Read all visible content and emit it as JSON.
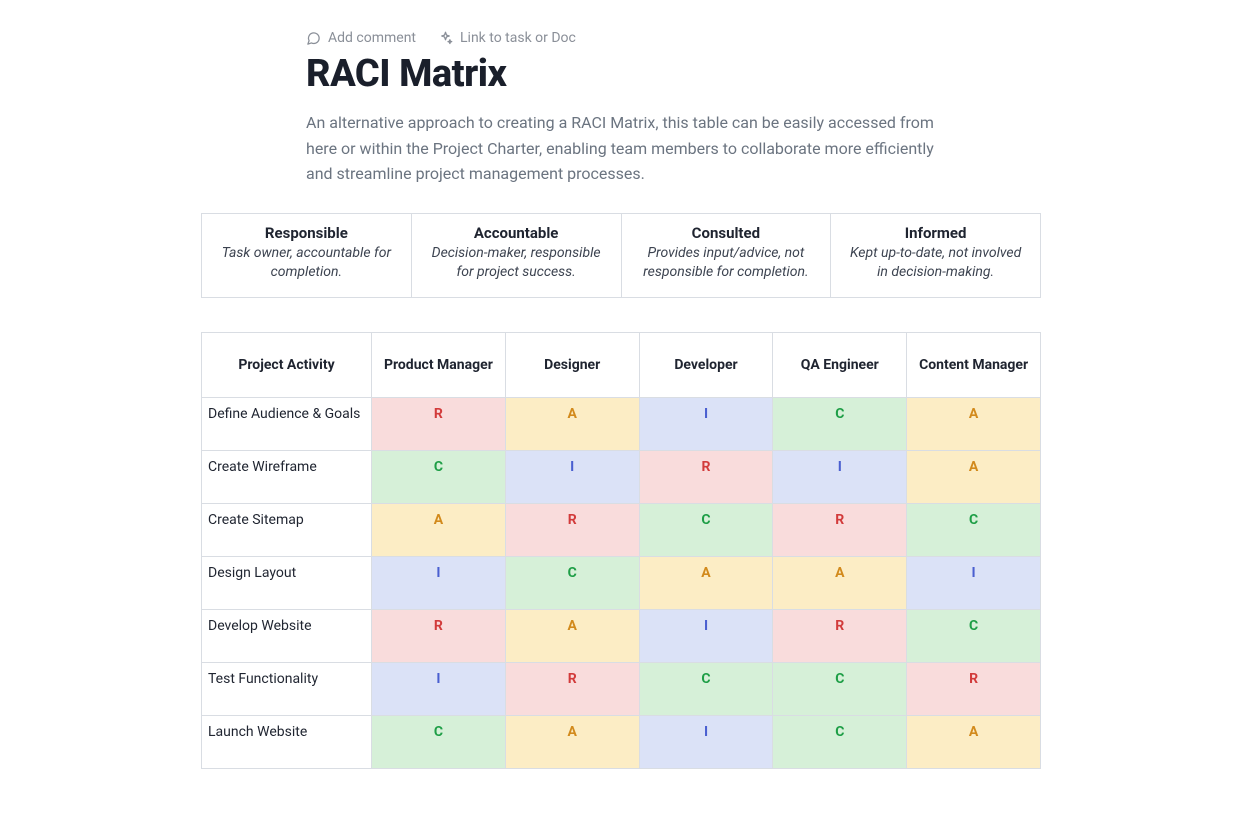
{
  "toolbar": {
    "add_comment": "Add comment",
    "link_task": "Link to task or Doc"
  },
  "title": "RACI Matrix",
  "description": "An alternative approach to creating a RACI Matrix, this table can be easily accessed from here or within the Project Charter, enabling team members to collaborate more efficiently and streamline project management processes.",
  "legend": [
    {
      "title": "Responsible",
      "sub": "Task owner, accountable for completion."
    },
    {
      "title": "Accountable",
      "sub": "Decision-maker, responsible for project success."
    },
    {
      "title": "Consulted",
      "sub": "Provides input/advice, not responsible for completion."
    },
    {
      "title": "Informed",
      "sub": "Kept up-to-date, not involved in decision-making."
    }
  ],
  "matrix": {
    "first_col_header": "Project Activity",
    "roles": [
      "Product Manager",
      "Designer",
      "Developer",
      "QA Engineer",
      "Content Manager"
    ],
    "rows": [
      {
        "activity": "Define Audience & Goals",
        "cells": [
          "R",
          "A",
          "I",
          "C",
          "A"
        ]
      },
      {
        "activity": "Create Wireframe",
        "cells": [
          "C",
          "I",
          "R",
          "I",
          "A"
        ]
      },
      {
        "activity": "Create Sitemap",
        "cells": [
          "A",
          "R",
          "C",
          "R",
          "C"
        ]
      },
      {
        "activity": "Design Layout",
        "cells": [
          "I",
          "C",
          "A",
          "A",
          "I"
        ]
      },
      {
        "activity": "Develop Website",
        "cells": [
          "R",
          "A",
          "I",
          "R",
          "C"
        ]
      },
      {
        "activity": "Test Functionality",
        "cells": [
          "I",
          "R",
          "C",
          "C",
          "R"
        ]
      },
      {
        "activity": "Launch Website",
        "cells": [
          "C",
          "A",
          "I",
          "C",
          "A"
        ]
      }
    ]
  }
}
